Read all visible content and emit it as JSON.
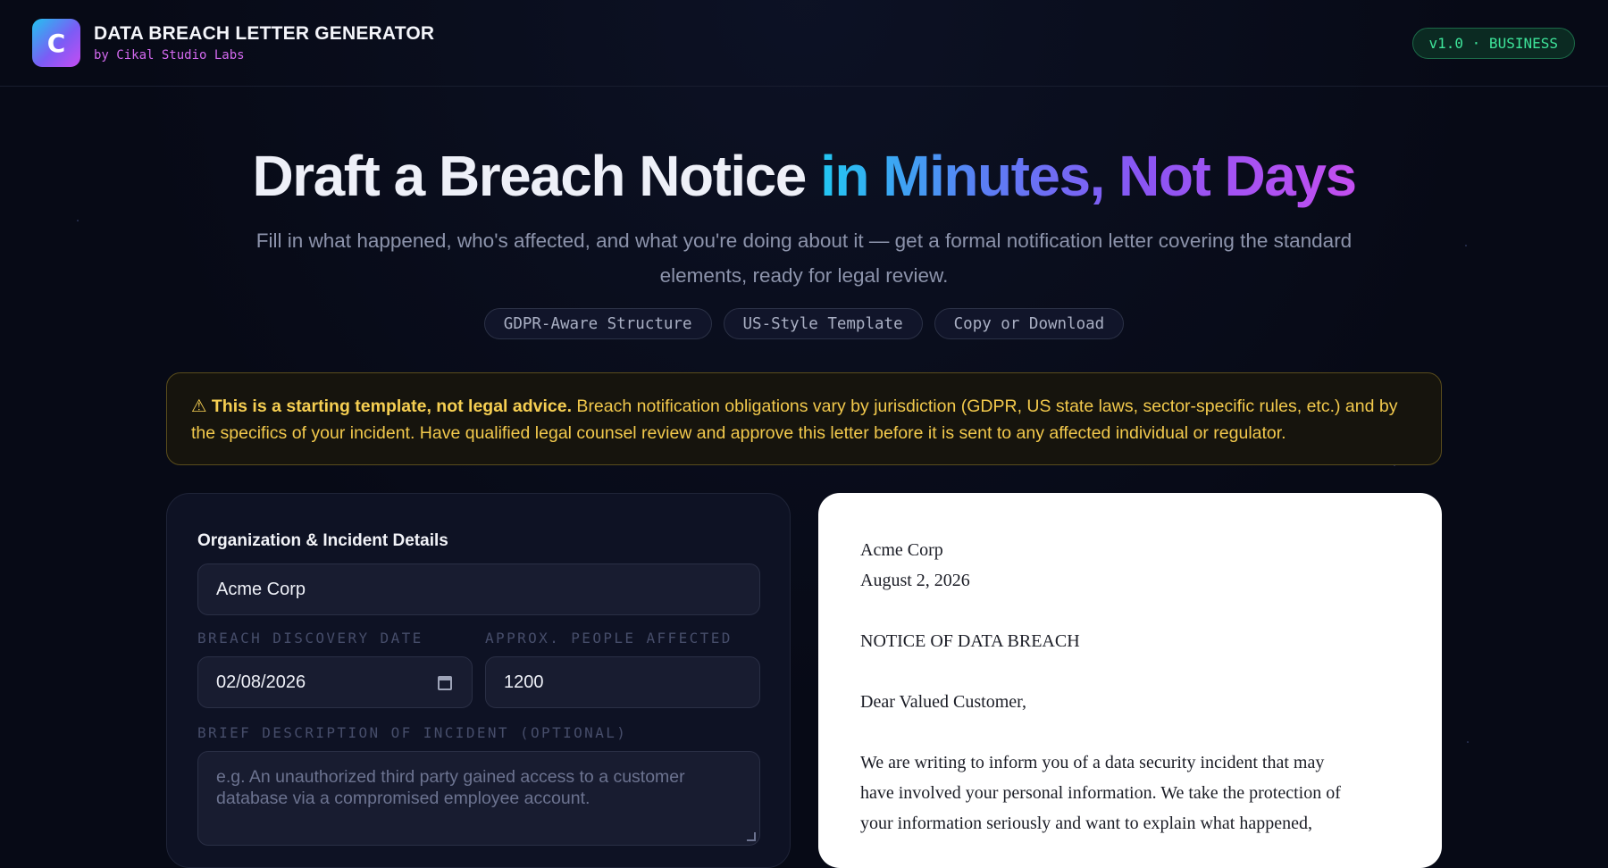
{
  "app": {
    "logo_letter": "C",
    "title": "DATA BREACH LETTER GENERATOR",
    "subtitle": "by Cikal Studio Labs",
    "version_badge": "v1.0 · BUSINESS"
  },
  "hero": {
    "title_plain": "Draft a Breach Notice",
    "title_gradient": "in Minutes, Not Days",
    "subtitle": "Fill in what happened, who's affected, and what you're doing about it — get a formal notification letter covering the standard elements, ready for legal review.",
    "chips": [
      "GDPR-Aware Structure",
      "US-Style Template",
      "Copy or Download"
    ]
  },
  "warning": {
    "icon": "warning-icon",
    "bold": "⚠ This is a starting template, not legal advice.",
    "text": " Breach notification obligations vary by jurisdiction (GDPR, US state laws, sector-specific rules, etc.) and by the specifics of your incident. Have qualified legal counsel review and approve this letter before it is sent to any affected individual or regulator."
  },
  "form": {
    "section_title": "Organization & Incident Details",
    "org_name_value": "Acme Corp",
    "discovery_date_label": "BREACH DISCOVERY DATE",
    "discovery_date_value": "02/08/2026",
    "people_affected_label": "APPROX. PEOPLE AFFECTED",
    "people_affected_value": "1200",
    "description_label": "BRIEF DESCRIPTION OF INCIDENT (OPTIONAL)",
    "description_placeholder": "e.g. An unauthorized third party gained access to a customer database via a compromised employee account."
  },
  "letter": {
    "org": "Acme Corp",
    "date": "August 2, 2026",
    "heading": "NOTICE OF DATA BREACH",
    "salutation": "Dear Valued Customer,",
    "body_line1": "We are writing to inform you of a data security incident that may",
    "body_line2": "have involved your personal information. We take the protection of",
    "body_line3": "your information seriously and want to explain what happened,"
  },
  "colors": {
    "background": "#070a16",
    "accent_green": "#3ee49a",
    "warning_yellow": "#f2c94c",
    "gradient_start": "#22c7f2",
    "gradient_end": "#c44ef0"
  }
}
